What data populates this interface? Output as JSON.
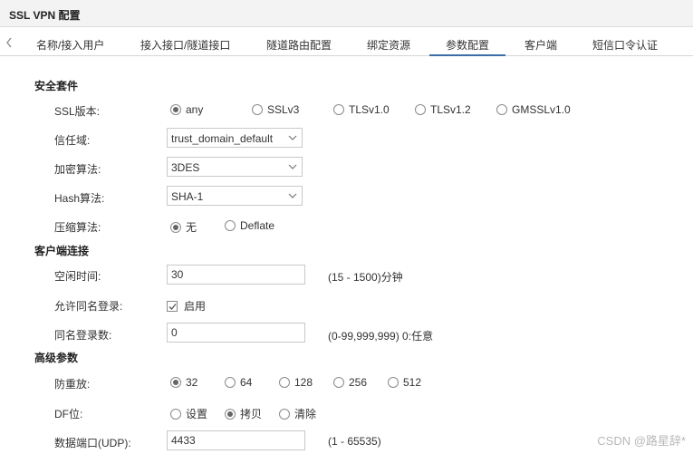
{
  "window": {
    "title": "SSL VPN 配置"
  },
  "tabs": [
    {
      "label": "名称/接入用户"
    },
    {
      "label": "接入接口/隧道接口"
    },
    {
      "label": "隧道路由配置"
    },
    {
      "label": "绑定资源"
    },
    {
      "label": "参数配置"
    },
    {
      "label": "客户端"
    },
    {
      "label": "短信口令认证"
    }
  ],
  "active_tab": "参数配置",
  "security": {
    "section_title": "安全套件",
    "ssl_version": {
      "label": "SSL版本:",
      "options": [
        "any",
        "SSLv3",
        "TLSv1.0",
        "TLSv1.2",
        "GMSSLv1.0"
      ],
      "selected": "any"
    },
    "trust_domain": {
      "label": "信任域:",
      "value": "trust_domain_default"
    },
    "encryption": {
      "label": "加密算法:",
      "value": "3DES"
    },
    "hash": {
      "label": "Hash算法:",
      "value": "SHA-1"
    },
    "compression": {
      "label": "压缩算法:",
      "options": [
        "无",
        "Deflate"
      ],
      "selected": "无"
    }
  },
  "client": {
    "section_title": "客户端连接",
    "idle_time": {
      "label": "空闲时间:",
      "value": "30",
      "hint": "(15 - 1500)分钟"
    },
    "same_name_login": {
      "label": "允许同名登录:",
      "checkbox_label": "启用",
      "checked": true
    },
    "same_name_count": {
      "label": "同名登录数:",
      "value": "0",
      "hint": "(0-99,999,999) 0:任意"
    }
  },
  "advanced": {
    "section_title": "高级参数",
    "anti_replay": {
      "label": "防重放:",
      "options": [
        "32",
        "64",
        "128",
        "256",
        "512"
      ],
      "selected": "32"
    },
    "df_bit": {
      "label": "DF位:",
      "options": [
        "设置",
        "拷贝",
        "清除"
      ],
      "selected": "拷贝"
    },
    "data_port": {
      "label": "数据端口(UDP):",
      "value": "4433",
      "hint": "(1 - 65535)"
    }
  },
  "watermark": "CSDN @路星辞*",
  "icons": {
    "tab_scroll": "chevron-left-icon",
    "select_arrow": "chevron-down-icon",
    "checkbox": "checkmark-icon"
  }
}
